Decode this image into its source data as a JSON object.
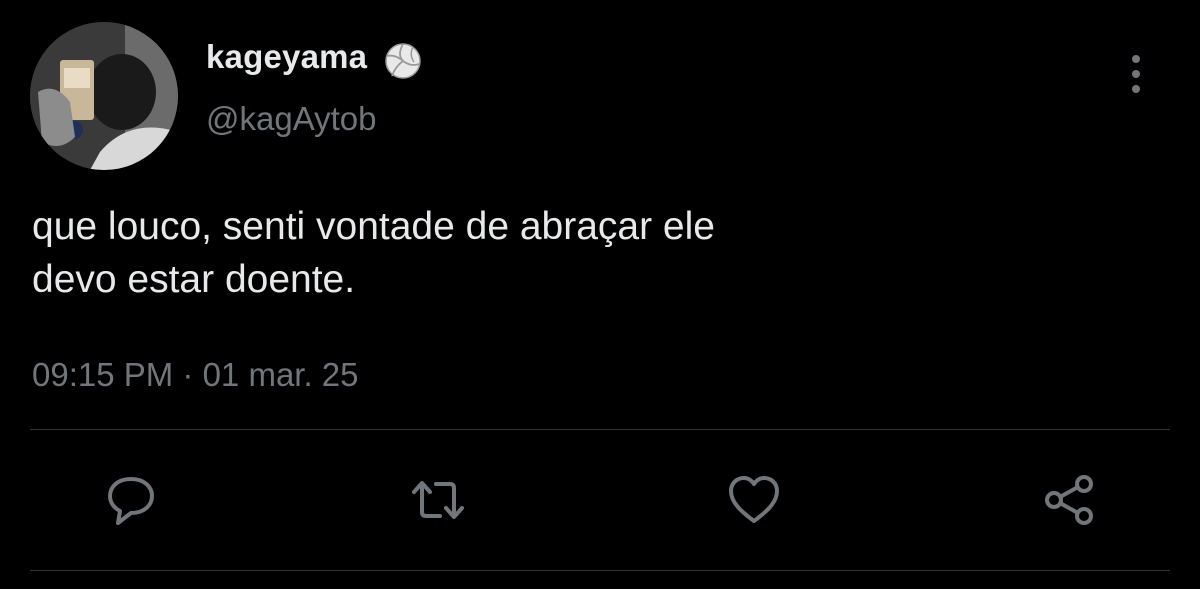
{
  "user": {
    "display_name": "kageyama",
    "handle": "@kagAytob",
    "badge_icon": "volleyball-icon"
  },
  "tweet": {
    "lines": [
      "que louco, senti vontade de abraçar ele",
      "devo estar doente."
    ],
    "timestamp": "09:15 PM · 01 mar. 25"
  },
  "actions": {
    "reply_icon": "comment-icon",
    "retweet_icon": "retweet-icon",
    "like_icon": "heart-icon",
    "share_icon": "share-icon"
  },
  "colors": {
    "background": "#000000",
    "primary_text": "#e7e9ea",
    "secondary_text": "#71767b",
    "divider": "#2f3336"
  }
}
